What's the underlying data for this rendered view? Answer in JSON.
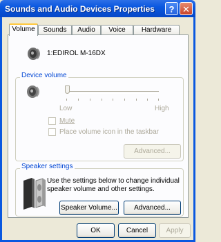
{
  "window": {
    "title": "Sounds and Audio Devices Properties",
    "help_glyph": "?",
    "close_glyph": "✕"
  },
  "tabs": [
    {
      "label": "Volume",
      "active": true
    },
    {
      "label": "Sounds",
      "active": false
    },
    {
      "label": "Audio",
      "active": false
    },
    {
      "label": "Voice",
      "active": false
    },
    {
      "label": "Hardware",
      "active": false
    }
  ],
  "device": {
    "name": "1:EDIROL M-16DX"
  },
  "device_volume": {
    "group_label": "Device volume",
    "low_label": "Low",
    "high_label": "High",
    "level": 0,
    "mute_label": "Mute",
    "taskbar_label": "Place volume icon in the taskbar",
    "advanced_label": "Advanced..."
  },
  "speaker_settings": {
    "group_label": "Speaker settings",
    "description": "Use the settings below to change individual speaker volume and other settings.",
    "speaker_volume_label": "Speaker Volume...",
    "advanced_label": "Advanced..."
  },
  "footer": {
    "ok_label": "OK",
    "cancel_label": "Cancel",
    "apply_label": "Apply"
  },
  "colors": {
    "title_bar": "#0A58E0",
    "group_label": "#0046D5",
    "disabled_text": "#ACA899",
    "tab_highlight": "#FFC83C"
  }
}
